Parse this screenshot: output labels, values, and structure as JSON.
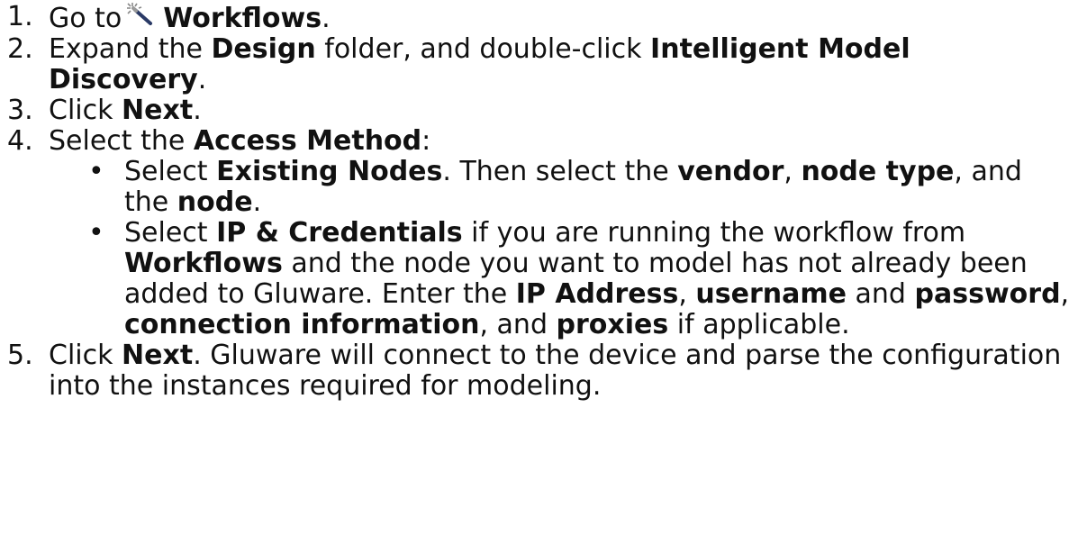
{
  "steps": [
    {
      "number": "1.",
      "parts": [
        "Go to",
        "Workflows",
        "."
      ]
    },
    {
      "number": "2.",
      "parts": [
        "Expand the ",
        "Design",
        " folder, and double-click ",
        "Intelligent Model Discovery",
        "."
      ]
    },
    {
      "number": "3.",
      "parts": [
        "Click ",
        "Next",
        "."
      ]
    },
    {
      "number": "4.",
      "parts": [
        "Select the ",
        "Access Method",
        ":"
      ]
    },
    {
      "number": "5.",
      "parts": [
        "Click ",
        "Next",
        ". Gluware will connect to the device and parse the configuration into the instances required for modeling."
      ]
    }
  ],
  "access_methods": [
    {
      "bullet": "•",
      "parts": [
        "Select ",
        "Existing Nodes",
        ". Then select the ",
        "vendor",
        ", ",
        "node type",
        ", and the ",
        "node",
        "."
      ]
    },
    {
      "bullet": "•",
      "parts": [
        "Select ",
        "IP & Credentials",
        " if you are running the workflow from ",
        "Workflows",
        " and the node you want to model has not already been added to Gluware. Enter the ",
        "IP Address",
        ", ",
        "username",
        " and ",
        "password",
        ", ",
        "connection information",
        ", and ",
        "proxies",
        " if applicable."
      ]
    }
  ],
  "icons": {
    "workflows": "magic-wand-icon"
  },
  "colors": {
    "text": "#111111",
    "wand_handle": "#2a3a66",
    "wand_sparkle": "#8a8a8a"
  }
}
